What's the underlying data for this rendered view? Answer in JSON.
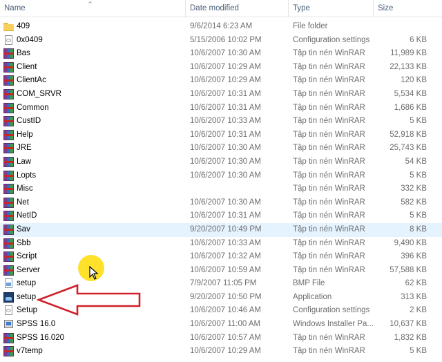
{
  "columns": {
    "name": "Name",
    "date": "Date modified",
    "type": "Type",
    "size": "Size"
  },
  "sort_icon": "chevron-up-icon",
  "files": [
    {
      "name": "409",
      "date": "9/6/2014 6:23 AM",
      "type": "File folder",
      "size": "",
      "icon": "folder-icon"
    },
    {
      "name": "0x0409",
      "date": "5/15/2006 10:02 PM",
      "type": "Configuration settings",
      "size": "6 KB",
      "icon": "config-file-icon"
    },
    {
      "name": "Bas",
      "date": "10/6/2007 10:30 AM",
      "type": "Tập tin nén WinRAR",
      "size": "11,989 KB",
      "icon": "winrar-archive-icon"
    },
    {
      "name": "Client",
      "date": "10/6/2007 10:29 AM",
      "type": "Tập tin nén WinRAR",
      "size": "22,133 KB",
      "icon": "winrar-archive-icon"
    },
    {
      "name": "ClientAc",
      "date": "10/6/2007 10:29 AM",
      "type": "Tập tin nén WinRAR",
      "size": "120 KB",
      "icon": "winrar-archive-icon"
    },
    {
      "name": "COM_SRVR",
      "date": "10/6/2007 10:31 AM",
      "type": "Tập tin nén WinRAR",
      "size": "5,534 KB",
      "icon": "winrar-archive-icon"
    },
    {
      "name": "Common",
      "date": "10/6/2007 10:31 AM",
      "type": "Tập tin nén WinRAR",
      "size": "1,686 KB",
      "icon": "winrar-archive-icon"
    },
    {
      "name": "CustID",
      "date": "10/6/2007 10:33 AM",
      "type": "Tập tin nén WinRAR",
      "size": "5 KB",
      "icon": "winrar-archive-icon"
    },
    {
      "name": "Help",
      "date": "10/6/2007 10:31 AM",
      "type": "Tập tin nén WinRAR",
      "size": "52,918 KB",
      "icon": "winrar-archive-icon"
    },
    {
      "name": "JRE",
      "date": "10/6/2007 10:30 AM",
      "type": "Tập tin nén WinRAR",
      "size": "25,743 KB",
      "icon": "winrar-archive-icon"
    },
    {
      "name": "Law",
      "date": "10/6/2007 10:30 AM",
      "type": "Tập tin nén WinRAR",
      "size": "54 KB",
      "icon": "winrar-archive-icon"
    },
    {
      "name": "Lopts",
      "date": "10/6/2007 10:30 AM",
      "type": "Tập tin nén WinRAR",
      "size": "5 KB",
      "icon": "winrar-archive-icon"
    },
    {
      "name": "Misc",
      "date": "",
      "type": "Tập tin nén WinRAR",
      "size": "332 KB",
      "icon": "winrar-archive-icon"
    },
    {
      "name": "Net",
      "date": "10/6/2007 10:30 AM",
      "type": "Tập tin nén WinRAR",
      "size": "582 KB",
      "icon": "winrar-archive-icon"
    },
    {
      "name": "NetID",
      "date": "10/6/2007 10:31 AM",
      "type": "Tập tin nén WinRAR",
      "size": "5 KB",
      "icon": "winrar-archive-icon"
    },
    {
      "name": "Sav",
      "date": "9/20/2007 10:49 PM",
      "type": "Tập tin nén WinRAR",
      "size": "8 KB",
      "icon": "winrar-archive-icon",
      "selected": true
    },
    {
      "name": "Sbb",
      "date": "10/6/2007 10:33 AM",
      "type": "Tập tin nén WinRAR",
      "size": "9,490 KB",
      "icon": "winrar-archive-icon"
    },
    {
      "name": "Script",
      "date": "10/6/2007 10:32 AM",
      "type": "Tập tin nén WinRAR",
      "size": "396 KB",
      "icon": "winrar-archive-icon"
    },
    {
      "name": "Server",
      "date": "10/6/2007 10:59 AM",
      "type": "Tập tin nén WinRAR",
      "size": "57,588 KB",
      "icon": "winrar-archive-icon"
    },
    {
      "name": "setup",
      "date": "7/9/2007 11:05 PM",
      "type": "BMP File",
      "size": "62 KB",
      "icon": "bmp-image-icon"
    },
    {
      "name": "setup",
      "date": "9/20/2007 10:50 PM",
      "type": "Application",
      "size": "313 KB",
      "icon": "application-icon"
    },
    {
      "name": "Setup",
      "date": "10/6/2007 10:46 AM",
      "type": "Configuration settings",
      "size": "2 KB",
      "icon": "config-file-icon"
    },
    {
      "name": "SPSS 16.0",
      "date": "10/6/2007 11:00 AM",
      "type": "Windows Installer Pa...",
      "size": "10,637 KB",
      "icon": "installer-package-icon"
    },
    {
      "name": "SPSS 16.020",
      "date": "10/6/2007 10:57 AM",
      "type": "Tập tin nén WinRAR",
      "size": "1,832 KB",
      "icon": "winrar-archive-icon"
    },
    {
      "name": "v7temp",
      "date": "10/6/2007 10:29 AM",
      "type": "Tập tin nén WinRAR",
      "size": "5 KB",
      "icon": "winrar-archive-icon"
    }
  ],
  "annotations": {
    "highlight_color": "#ffde1f",
    "arrow_color": "#d0202a",
    "arrow_target": "setup"
  }
}
